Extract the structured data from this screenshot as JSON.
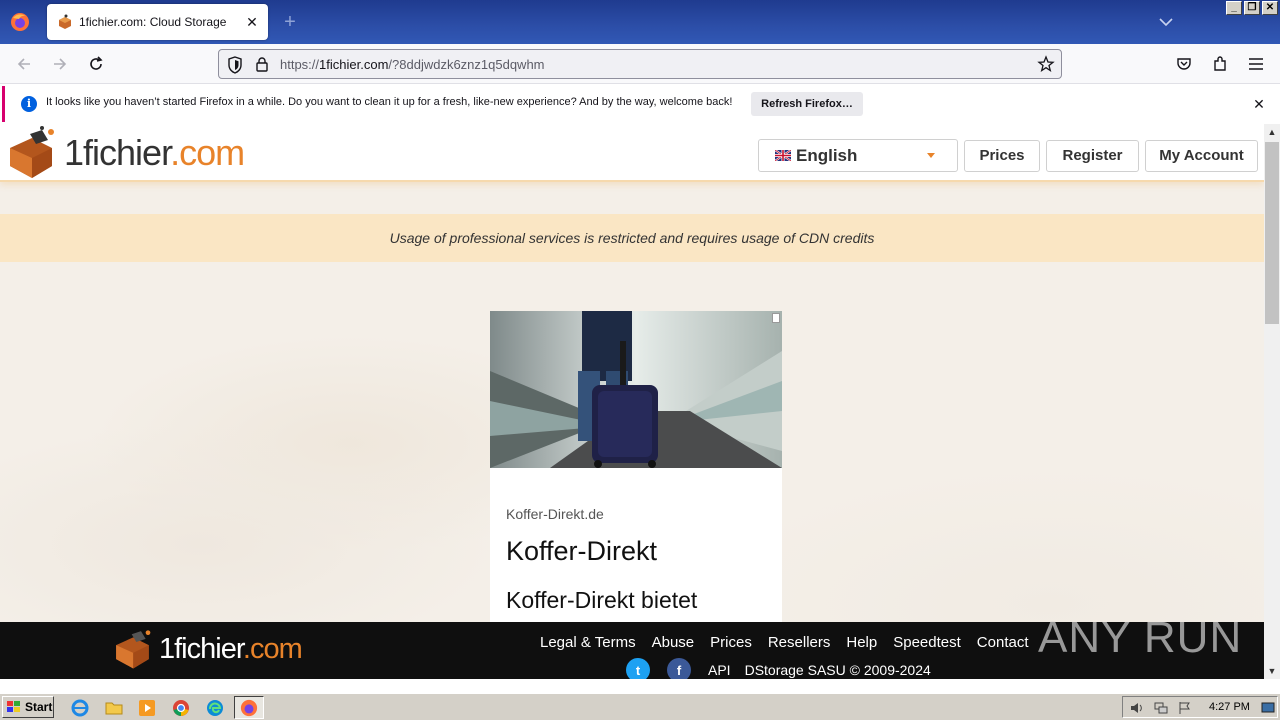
{
  "browser": {
    "tab_title": "1fichier.com: Cloud Storage",
    "new_tab_label": "+",
    "url_prefix": "https://",
    "url_domain": "1fichier.com",
    "url_path": "/?8ddjwdzk6znz1q5dqwhm",
    "notification_text": "It looks like you haven’t started Firefox in a while. Do you want to clean it up for a fresh, like-new experience? And by the way, welcome back!",
    "notification_button": "Refresh Firefox…",
    "notification_accent": "#d7006e"
  },
  "site": {
    "logo_text_1": "1fichier",
    "logo_text_2": ".com",
    "language": "English",
    "nav": {
      "prices": "Prices",
      "register": "Register",
      "my_account": "My Account"
    },
    "notice": "Usage of professional services is restricted and requires usage of CDN credits",
    "accent_color": "#e8832a"
  },
  "ad": {
    "source": "Koffer-Direkt.de",
    "headline": "Koffer-Direkt",
    "body": "Koffer-Direkt bietet"
  },
  "footer": {
    "links": [
      "Legal & Terms",
      "Abuse",
      "Prices",
      "Resellers",
      "Help",
      "Speedtest",
      "Contact"
    ],
    "api": "API",
    "copyright": "DStorage SASU © 2009-2024",
    "social": [
      "twitter-icon",
      "facebook-icon"
    ]
  },
  "watermark": "ANY RUN",
  "taskbar": {
    "start": "Start",
    "clock": "4:27 PM"
  }
}
